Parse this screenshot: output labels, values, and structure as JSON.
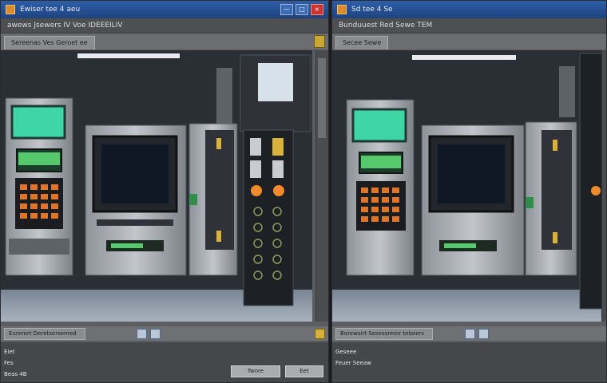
{
  "left_window": {
    "title": "Ewiser tee 4 aeu",
    "menu": "awews Jsewers IV Voe IDEEEILIV",
    "tab": "Sereenas Ves Geroet ee",
    "status_field": "Eurerert Deretsersemed",
    "info_lines": [
      "Eiet",
      "Fes",
      "Beas 4B"
    ],
    "buttons": [
      "Twore",
      "Eet"
    ],
    "window_buttons": [
      "minimize",
      "maximize",
      "close"
    ]
  },
  "right_window": {
    "title": "Sd tee 4 Se",
    "menu": "Bunduuest Red Sewe TEM",
    "tab": "Secee Sewe",
    "status_field": "Borewsirt Sesessreror tebeers",
    "info_lines": [
      "Geseee",
      "Feuer Seeaw"
    ],
    "window_buttons": []
  },
  "colors": {
    "titlebar": "#2e5ea8",
    "chrome": "#5b5d61",
    "screen_glow": "#3fd6a6",
    "keypad": "#e0752a"
  },
  "icons": [
    "app-icon",
    "minimize-icon",
    "maximize-icon",
    "close-icon",
    "scroll-up-icon",
    "status-info-icon",
    "status-warning-icon"
  ]
}
